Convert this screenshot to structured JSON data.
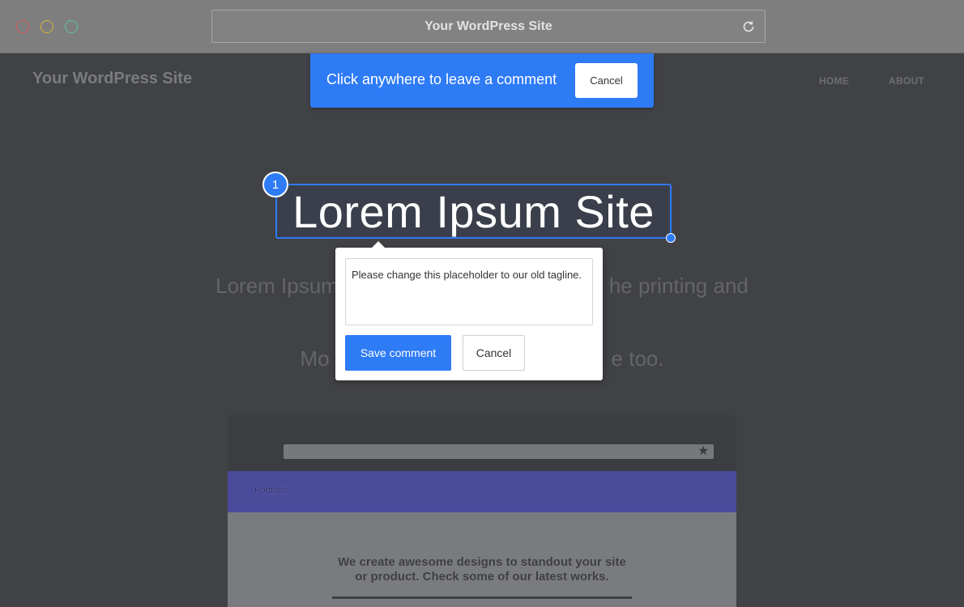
{
  "browser": {
    "address_title": "Your WordPress Site",
    "traffic_lights": [
      "close",
      "minimize",
      "zoom"
    ],
    "reload_icon": "reload-icon"
  },
  "site": {
    "title": "Your WordPress Site",
    "nav": {
      "home": "HOME",
      "about": "ABOUT"
    }
  },
  "comment_banner": {
    "text": "Click anywhere to leave a comment",
    "cancel_label": "Cancel",
    "color": "#2e7bf6"
  },
  "hero": {
    "heading": "Lorem Ipsum Site",
    "marker_number": "1",
    "line1_left": "Lorem Ipsum",
    "line1_right": "he printing and",
    "line2_left": "Mo",
    "line2_right": "e too."
  },
  "comment_popup": {
    "text": "Please change this placeholder to our old tagline.",
    "save_label": "Save comment",
    "cancel_label": "Cancel"
  },
  "preview": {
    "nav_label": "Portfolio",
    "tagline_line1": "We create awesome designs to standout your site",
    "tagline_line2": "or product. Check some of our latest works.",
    "star_icon": "star-icon"
  }
}
